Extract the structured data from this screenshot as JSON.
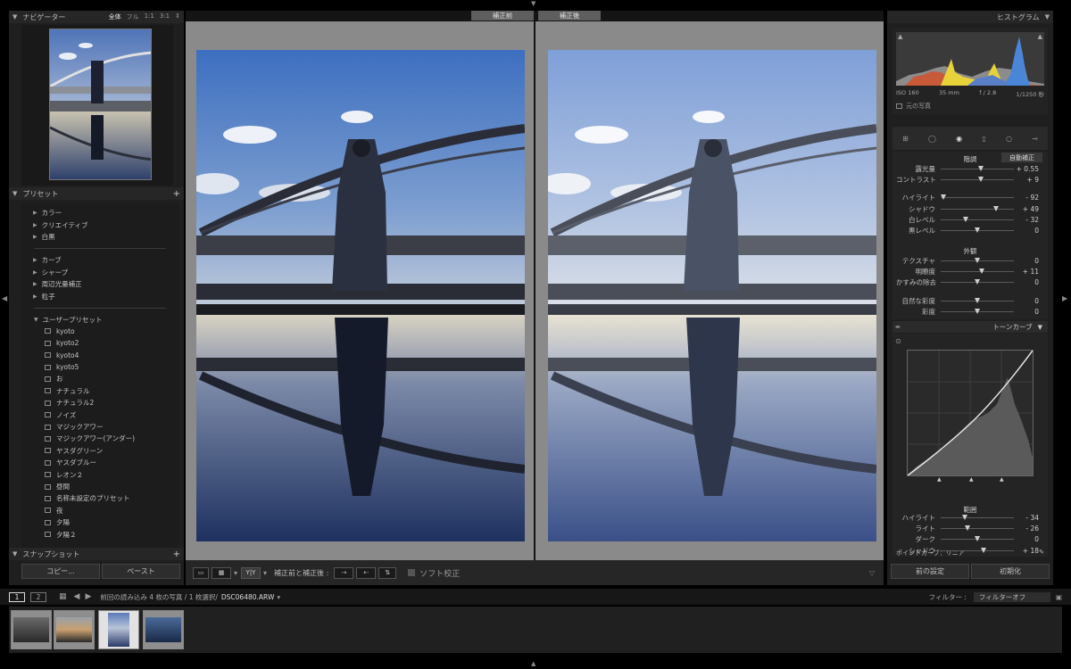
{
  "navigator": {
    "title": "ナビゲーター",
    "zoom_options": [
      "全体",
      "フル",
      "1:1",
      "3:1"
    ]
  },
  "presets": {
    "title": "プリセット",
    "add": "+",
    "basic_groups": [
      "カラー",
      "クリエイティブ",
      "白黒"
    ],
    "effect_groups": [
      "カーブ",
      "シャープ",
      "周辺光量補正",
      "粒子"
    ],
    "user_group": "ユーザープリセット",
    "user_items": [
      "kyoto",
      "kyoto2",
      "kyoto4",
      "kyoto5",
      "お",
      "ナチュラル",
      "ナチュラル2",
      "ノイズ",
      "マジックアワー",
      "マジックアワー(アンダー)",
      "ヤスダグリーン",
      "ヤスダブルー",
      "レオン２",
      "昼間",
      "名称未設定のプリセット",
      "夜",
      "夕陽",
      "夕陽２"
    ]
  },
  "snapshot": {
    "title": "スナップショット",
    "add": "+"
  },
  "left_buttons": {
    "copy": "コピー...",
    "paste": "ペースト"
  },
  "compare": {
    "before": "補正前",
    "after": "補正後"
  },
  "toolbar": {
    "view_label": "補正前と補正後 :",
    "yy": "Y|Y",
    "softproof": "ソフト校正"
  },
  "histogram": {
    "title": "ヒストグラム",
    "iso": "ISO 160",
    "focal": "35 mm",
    "aperture": "f / 2.8",
    "shutter": "1/1250 秒",
    "original": "元の写真"
  },
  "basic": {
    "tone_title": "階調",
    "auto": "自動補正",
    "presence_title": "外観",
    "tone": [
      {
        "label": "露光量",
        "value": "+ 0.55",
        "pos": 0.55
      },
      {
        "label": "コントラスト",
        "value": "+ 9",
        "pos": 0.55
      },
      {
        "label": "ハイライト",
        "value": "- 92",
        "pos": 0.04
      },
      {
        "label": "シャドウ",
        "value": "+ 49",
        "pos": 0.75
      },
      {
        "label": "白レベル",
        "value": "- 32",
        "pos": 0.34
      },
      {
        "label": "黒レベル",
        "value": "0",
        "pos": 0.5
      }
    ],
    "presence": [
      {
        "label": "テクスチャ",
        "value": "0",
        "pos": 0.5
      },
      {
        "label": "明瞭度",
        "value": "+ 11",
        "pos": 0.56
      },
      {
        "label": "かすみの除去",
        "value": "0",
        "pos": 0.5
      },
      {
        "label": "自然な彩度",
        "value": "0",
        "pos": 0.5
      },
      {
        "label": "彩度",
        "value": "0",
        "pos": 0.5
      }
    ]
  },
  "tonecurve": {
    "title": "トーンカーブ",
    "region": "範囲",
    "sliders": [
      {
        "label": "ハイライト",
        "value": "- 34",
        "pos": 0.33
      },
      {
        "label": "ライト",
        "value": "- 26",
        "pos": 0.37
      },
      {
        "label": "ダーク",
        "value": "0",
        "pos": 0.5
      },
      {
        "label": "シャドウ",
        "value": "+ 18",
        "pos": 0.59
      }
    ],
    "point_curve": "ポイントカーブ：リニア"
  },
  "right_buttons": {
    "previous": "前の設定",
    "reset": "初期化"
  },
  "filmbar": {
    "page1": "1",
    "page2": "2",
    "path": "前回の読み込み  4 枚の写真 / 1 枚選択/",
    "filename": "DSC06480.ARW",
    "filter_label": "フィルター :",
    "filter_value": "フィルターオフ"
  }
}
